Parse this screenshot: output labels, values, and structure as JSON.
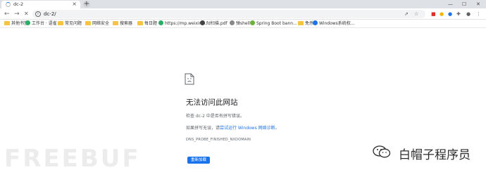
{
  "tab": {
    "title": "dc-2",
    "close": "×"
  },
  "newtab_label": "+",
  "window_controls": {
    "minimize": "—",
    "maximize": "☐",
    "close": "✕"
  },
  "nav": {
    "back": "←",
    "forward": "→",
    "stop": "✕"
  },
  "address_bar": {
    "url": "dc-2/",
    "info": "i"
  },
  "bookmarks": [
    {
      "label": "其他书签",
      "kind": "folder"
    },
    {
      "label": "工作台 · 语雀",
      "kind": "site",
      "color": "#2aae67"
    },
    {
      "label": "常见问题",
      "kind": "folder"
    },
    {
      "label": "网络安全",
      "kind": "folder"
    },
    {
      "label": "搜索器",
      "kind": "folder"
    },
    {
      "label": "每日题",
      "kind": "folder"
    },
    {
      "label": "https://mp.weixin....",
      "kind": "site",
      "color": "#2aae67"
    },
    {
      "label": "fd扫描.pdf",
      "kind": "site",
      "color": "#444444"
    },
    {
      "label": "弹shell",
      "kind": "site",
      "color": "#888888"
    },
    {
      "label": "Spring Boot bann...",
      "kind": "site",
      "color": "#6cb33e"
    },
    {
      "label": "免杀",
      "kind": "folder"
    },
    {
      "label": "Windows系统权... ",
      "kind": "site",
      "color": "#1a73e8"
    }
  ],
  "error": {
    "title": "无法访问此网站",
    "line1": "检查 dc-2 中是否有拼写错误。",
    "line2_prefix": "如果拼写无误，请",
    "line2_link": "尝试运行 Windows 网络诊断",
    "line2_suffix": "。",
    "code": "DNS_PROBE_FINISHED_NXDOMAIN",
    "button": "重新加载"
  },
  "watermark": {
    "left": "FREEBUF",
    "right": "白帽子程序员"
  },
  "colors": {
    "accent": "#1a73e8",
    "tabstrip": "#dee1e6"
  }
}
